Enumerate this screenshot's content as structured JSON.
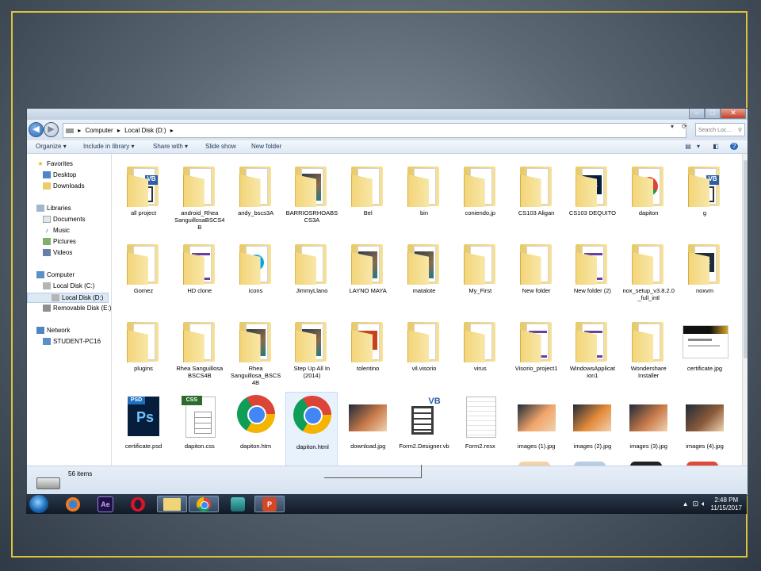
{
  "explorer": {
    "address": {
      "crumbs": [
        "Computer",
        "Local Disk (D:)"
      ],
      "search_placeholder": "Search Loc..."
    },
    "toolbar": {
      "organize": "Organize",
      "include_in_library": "Include in library",
      "share_with": "Share with",
      "slide_show": "Slide show",
      "new_folder": "New folder"
    },
    "nav": {
      "favorites": "Favorites",
      "desktop": "Desktop",
      "downloads": "Downloads",
      "libraries": "Libraries",
      "documents": "Documents",
      "music": "Music",
      "pictures": "Pictures",
      "videos": "Videos",
      "computer": "Computer",
      "local_c": "Local Disk (C:)",
      "local_d": "Local Disk (D:)",
      "removable_e": "Removable Disk (E:)",
      "network": "Network",
      "student_pc": "STUDENT-PC16"
    },
    "items": [
      {
        "name": "all project",
        "kind": "folder-vb"
      },
      {
        "name": "android_Rhea SanguillosaBSCS4B",
        "kind": "folder"
      },
      {
        "name": "andy_bscs3A",
        "kind": "folder"
      },
      {
        "name": "BARRIOSRHOABS CS3A",
        "kind": "folder-img"
      },
      {
        "name": "Bel",
        "kind": "folder"
      },
      {
        "name": "bin",
        "kind": "folder"
      },
      {
        "name": "coniendo,jp",
        "kind": "folder"
      },
      {
        "name": "CS103 Aligan",
        "kind": "folder"
      },
      {
        "name": "CS103 DEQUITO",
        "kind": "folder-ps"
      },
      {
        "name": "dapiton",
        "kind": "folder-chrome"
      },
      {
        "name": "g",
        "kind": "folder-vb"
      },
      {
        "name": "Gomez",
        "kind": "folder"
      },
      {
        "name": "HD clone",
        "kind": "folder-vs"
      },
      {
        "name": "icons",
        "kind": "folder-skype"
      },
      {
        "name": "JimmyLlano",
        "kind": "folder"
      },
      {
        "name": "LAYNO MAYA",
        "kind": "folder-img"
      },
      {
        "name": "matalote",
        "kind": "folder-img"
      },
      {
        "name": "My_First",
        "kind": "folder"
      },
      {
        "name": "New folder",
        "kind": "folder"
      },
      {
        "name": "New folder (2)",
        "kind": "folder-vs"
      },
      {
        "name": "nox_setup_v3.8.2.0_full_intl",
        "kind": "folder"
      },
      {
        "name": "noxvm",
        "kind": "folder-nox"
      },
      {
        "name": "plugins",
        "kind": "folder"
      },
      {
        "name": "Rhea Sanguillosa BSCS4B",
        "kind": "folder"
      },
      {
        "name": "Rhea Sanguillosa_BSCS 4B",
        "kind": "folder-img"
      },
      {
        "name": "Step Up All In (2014)",
        "kind": "folder-img"
      },
      {
        "name": "tolentino",
        "kind": "folder-ai"
      },
      {
        "name": "vil.visorio",
        "kind": "folder"
      },
      {
        "name": "virus",
        "kind": "folder"
      },
      {
        "name": "Visorio_project1",
        "kind": "folder-vs"
      },
      {
        "name": "WindowsApplicat ion1",
        "kind": "folder-vs"
      },
      {
        "name": "Wondershare Installer",
        "kind": "folder"
      },
      {
        "name": "certificate.jpg",
        "kind": "cert"
      },
      {
        "name": "certificate.psd",
        "kind": "psd"
      },
      {
        "name": "dapiton.css",
        "kind": "css"
      },
      {
        "name": "dapiton.htm",
        "kind": "chrome"
      },
      {
        "name": "dapiton.html",
        "kind": "chrome",
        "selected": true
      },
      {
        "name": "download.jpg",
        "kind": "photo"
      },
      {
        "name": "Form2.Designer.vb",
        "kind": "vbfile"
      },
      {
        "name": "Form2.resx",
        "kind": "page"
      },
      {
        "name": "images (1).jpg",
        "kind": "photo"
      },
      {
        "name": "images (2).jpg",
        "kind": "photo"
      },
      {
        "name": "images (3).jpg",
        "kind": "photo"
      },
      {
        "name": "images (4).jpg",
        "kind": "photo"
      }
    ],
    "labels": {
      "vb": "VB",
      "ps": "Ps",
      "psd": "PSD",
      "css": "CSS",
      "ai": "AI",
      "nox": "nox"
    },
    "status": "56 items"
  },
  "taskbar": {
    "apps": [
      "firefox",
      "after-effects",
      "opera",
      "explorer",
      "chrome",
      "mimio",
      "powerpoint"
    ],
    "app_labels": {
      "ae": "Ae",
      "ppt": "P"
    },
    "time": "2:48 PM",
    "date": "11/15/2017"
  },
  "colors": {
    "frame": "#d9c43b",
    "folder": "#f3d57a",
    "selection": "#e8f2fd"
  }
}
